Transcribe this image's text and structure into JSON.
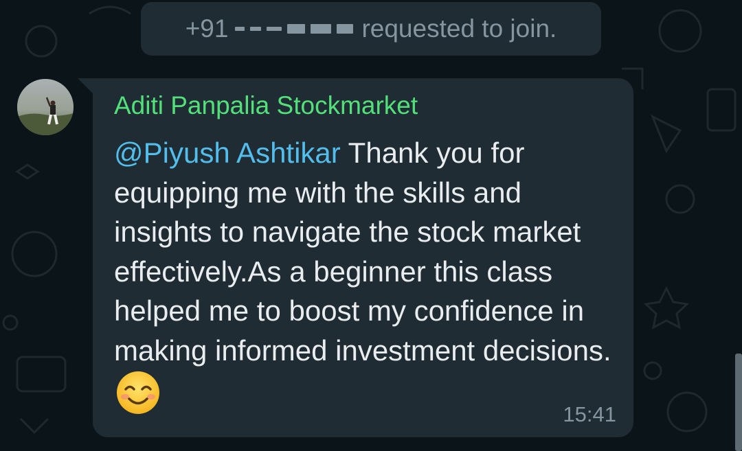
{
  "system_message": {
    "phone_prefix": "+91",
    "text": "requested to join."
  },
  "message": {
    "sender": "Aditi Panpalia Stockmarket",
    "mention": "@Piyush Ashtikar",
    "body": " Thank you for equipping me with the skills and insights to navigate the stock market effectively.As a beginner this class helped me to boost my confidence in making informed investment decisions.",
    "emoji": "smiling-face-emoji",
    "time": "15:41"
  },
  "colors": {
    "background": "#0b1419",
    "bubble": "#1f2c33",
    "sender": "#53e07b",
    "mention": "#53bdeb",
    "text": "#e9edef",
    "meta": "#8696a0"
  }
}
